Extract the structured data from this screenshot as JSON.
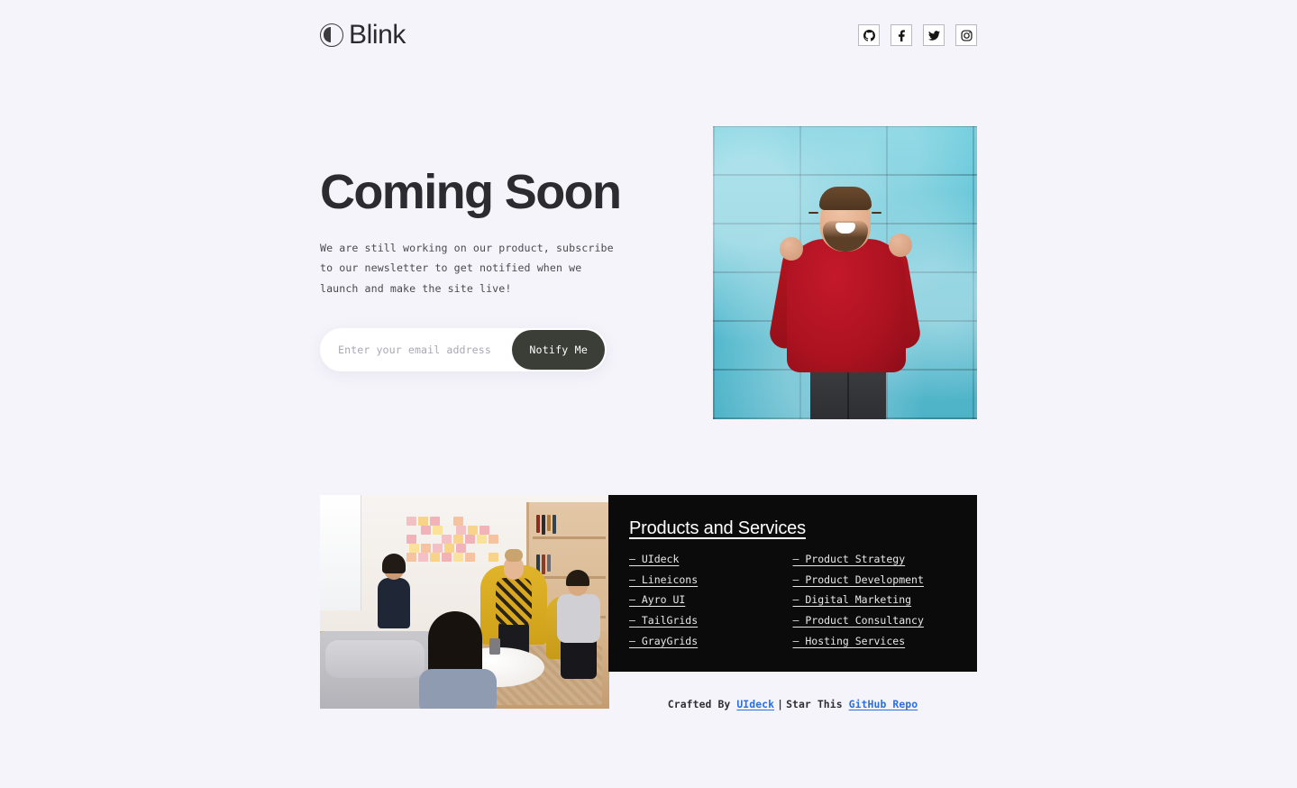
{
  "brand": {
    "name": "Blink",
    "logo_icon": "blink-circle-icon"
  },
  "socials": [
    {
      "name": "github",
      "label": "GitHub",
      "icon": "github-icon"
    },
    {
      "name": "facebook",
      "label": "Facebook",
      "icon": "facebook-icon"
    },
    {
      "name": "twitter",
      "label": "Twitter",
      "icon": "twitter-icon"
    },
    {
      "name": "instagram",
      "label": "Instagram",
      "icon": "instagram-icon"
    }
  ],
  "hero": {
    "title": "Coming Soon",
    "description": "We are still working on our product, subscribe to our newsletter to get notified when we launch and make the site live!",
    "email_placeholder": "Enter your email address",
    "email_value": "",
    "notify_label": "Notify Me",
    "image_alt": "Man in red sweater cheering against a turquoise brick wall"
  },
  "services": {
    "title": "Products and Services",
    "image_alt": "Team meeting in a bright office with yellow chairs and sticky notes",
    "column_left": [
      "– UIdeck",
      "– Lineicons",
      "– Ayro UI",
      "– TailGrids",
      "– GrayGrids"
    ],
    "column_right": [
      "– Product Strategy",
      "– Product Development",
      "– Digital Marketing",
      "– Product Consultancy",
      "– Hosting Services"
    ]
  },
  "footer": {
    "crafted_prefix": "Crafted By",
    "crafted_link": "UIdeck",
    "separator": "|",
    "star_prefix": "Star This",
    "star_link": "GitHub Repo"
  },
  "colors": {
    "page_background": "#f5f4fb",
    "text": "#2c2c30",
    "button": "#3a3e37",
    "panel": "#0b0b0b",
    "link": "#2b6fe0",
    "wall": "#5fc3d6",
    "sweater": "#ab1220"
  }
}
